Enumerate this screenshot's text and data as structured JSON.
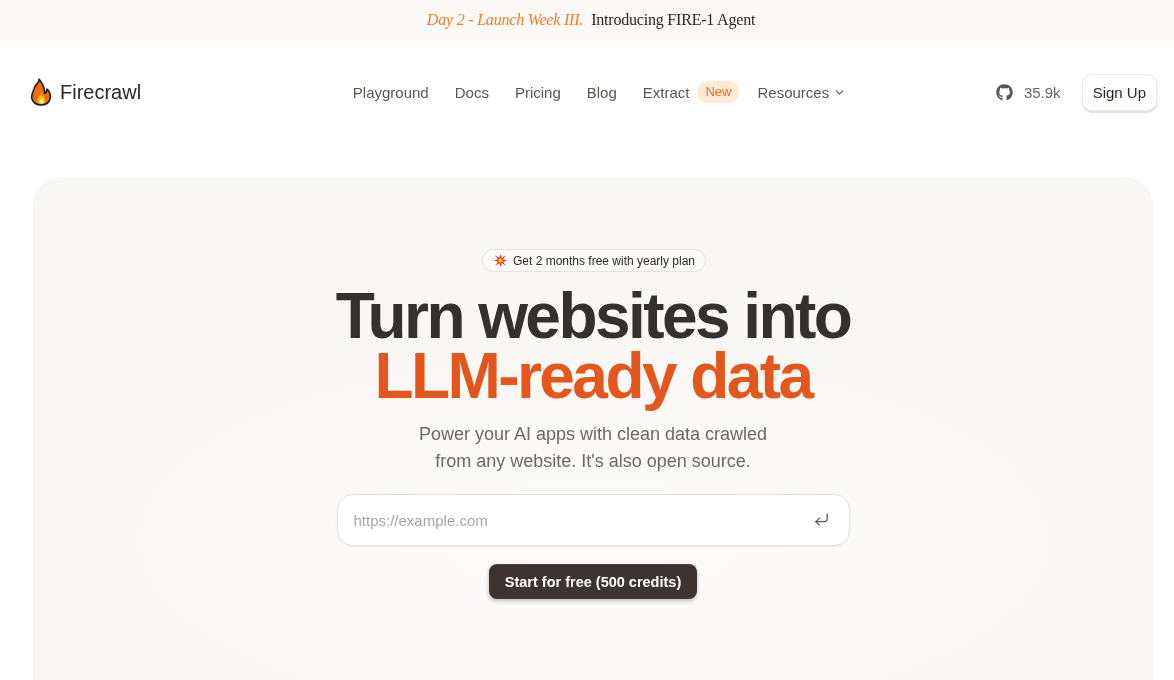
{
  "announcement": {
    "highlight": "Day 2 - Launch Week III.",
    "text": "Introducing FIRE-1 Agent"
  },
  "header": {
    "logo": {
      "name": "Firecrawl"
    },
    "nav": [
      {
        "label": "Playground",
        "kind": "link"
      },
      {
        "label": "Docs",
        "kind": "link"
      },
      {
        "label": "Pricing",
        "kind": "link"
      },
      {
        "label": "Blog",
        "kind": "link"
      },
      {
        "label": "Extract",
        "kind": "link",
        "badge": "New"
      },
      {
        "label": "Resources",
        "kind": "dropdown"
      }
    ],
    "github_stars": "35.9k",
    "sign_up": "Sign Up"
  },
  "hero": {
    "promo": "Get 2 months free with yearly plan",
    "title": "Turn websites into",
    "title_highlight": "LLM-ready data",
    "subtitle_lines": [
      "Power your AI apps with clean data crawled",
      "from any website. It's also open source."
    ],
    "url_field": {
      "placeholder": "https://example.com"
    },
    "cta": "Start for free (500 credits)"
  }
}
